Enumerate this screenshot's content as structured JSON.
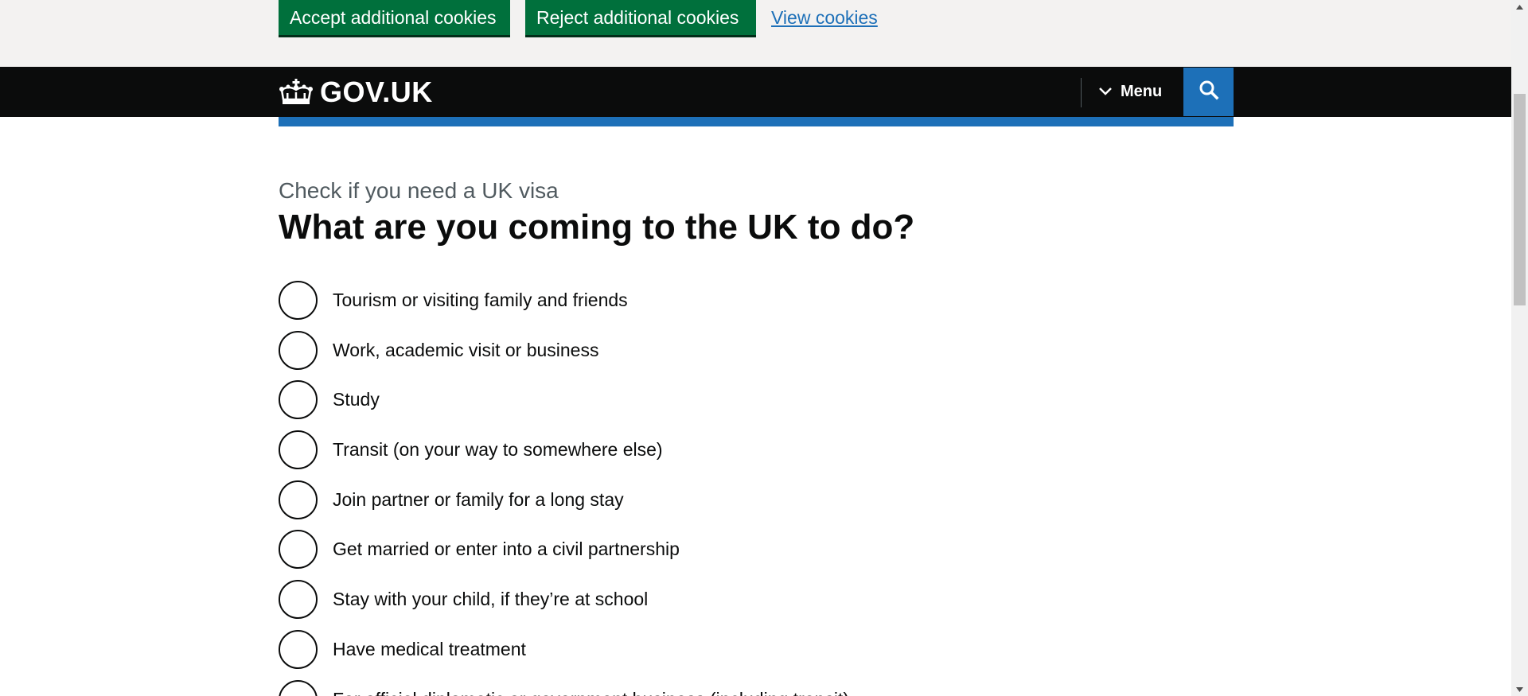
{
  "cookie_banner": {
    "accept_label": "Accept additional cookies",
    "reject_label": "Reject additional cookies",
    "view_label": "View cookies"
  },
  "header": {
    "logo_text": "GOV.UK",
    "menu_label": "Menu",
    "logo_icon": "crown-icon",
    "menu_icon": "chevron-down-icon",
    "search_icon": "search-icon"
  },
  "main": {
    "caption": "Check if you need a UK visa",
    "heading": "What are you coming to the UK to do?",
    "options": [
      {
        "label": "Tourism or visiting family and friends"
      },
      {
        "label": "Work, academic visit or business"
      },
      {
        "label": "Study"
      },
      {
        "label": "Transit (on your way to somewhere else)"
      },
      {
        "label": "Join partner or family for a long stay"
      },
      {
        "label": "Get married or enter into a civil partnership"
      },
      {
        "label": "Stay with your child, if they’re at school"
      },
      {
        "label": "Have medical treatment"
      },
      {
        "label": "For official diplomatic or government business (including transit)"
      }
    ]
  },
  "colors": {
    "button_green": "#00703c",
    "header_black": "#0b0c0c",
    "brand_blue": "#1d70b8",
    "banner_grey": "#f3f2f1",
    "caption_grey": "#505a5f"
  }
}
